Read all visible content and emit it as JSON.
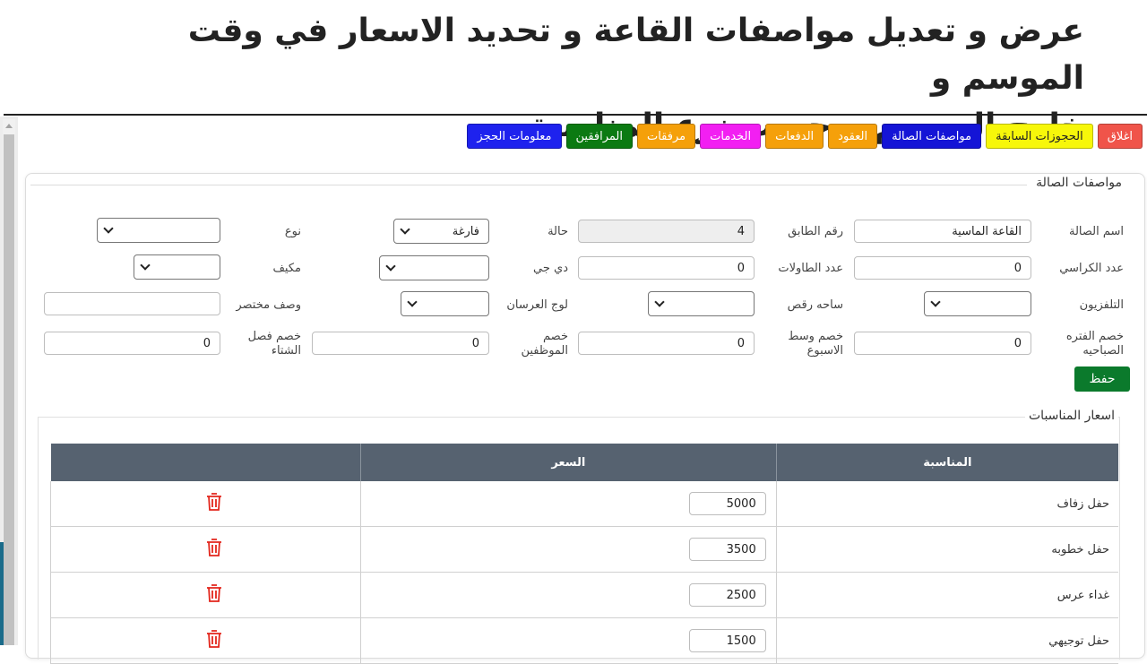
{
  "slide": {
    "title_line1": "عرض و تعديل مواصفات القاعة و تحديد الاسعار في وقت الموسم و",
    "title_line2": "خارج الموسم و حسب نوع المناسبة"
  },
  "toolbar": {
    "buttons": [
      {
        "label": "معلومات الحجز",
        "bg": "#1e22ee",
        "fg": "#ffffff"
      },
      {
        "label": "المرافقين",
        "bg": "#0b7a12",
        "fg": "#ffffff"
      },
      {
        "label": "مرفقات",
        "bg": "#f5a00a",
        "fg": "#ffffff"
      },
      {
        "label": "الخدمات",
        "bg": "#f21ff2",
        "fg": "#ffffff"
      },
      {
        "label": "الدفعات",
        "bg": "#f5a00a",
        "fg": "#ffffff"
      },
      {
        "label": "العقود",
        "bg": "#f5a00a",
        "fg": "#ffffff"
      },
      {
        "label": "مواصفات الصالة",
        "bg": "#1414d6",
        "fg": "#ffffff"
      },
      {
        "label": "الحجوزات السابقة",
        "bg": "#f7f70a",
        "fg": "#222222"
      },
      {
        "label": "اغلاق",
        "bg": "#f0544a",
        "fg": "#ffffff"
      }
    ]
  },
  "specs": {
    "legend": "مواصفات الصالة",
    "hall_name_label": "اسم الصالة",
    "hall_name_value": "القاعة الماسية",
    "floor_label": "رقم الطابق",
    "floor_value": "4",
    "status_label": "حالة",
    "status_value": "فارغة",
    "type_label": "نوع",
    "type_value": "",
    "chairs_label": "عدد الكراسي",
    "chairs_value": "0",
    "tables_label": "عدد الطاولات",
    "tables_value": "0",
    "dj_label": "دي جي",
    "dj_value": "",
    "ac_label": "مكيف",
    "ac_value": "",
    "tv_label": "التلفزيون",
    "tv_value": "",
    "dance_label": "ساحه رقص",
    "dance_value": "",
    "stage_label": "لوج العرسان",
    "stage_value": "",
    "short_desc_label": "وصف مختصر",
    "short_desc_value": "",
    "morning_disc_label": "خصم الفتره الصباحيه",
    "morning_disc_value": "0",
    "midweek_disc_label": "خصم وسط الاسبوع",
    "midweek_disc_value": "0",
    "staff_disc_label": "خصم الموظفين",
    "staff_disc_value": "0",
    "winter_disc_label": "خصم فصل الشتاء",
    "winter_disc_value": "0",
    "save_label": "حفظ"
  },
  "prices": {
    "legend": "اسعار المناسبات",
    "col_occasion": "المناسبة",
    "col_price": "السعر",
    "rows": [
      {
        "occasion": "حفل زفاف",
        "price": "5000"
      },
      {
        "occasion": "حفل خطوبه",
        "price": "3500"
      },
      {
        "occasion": "غداء عرس",
        "price": "2500"
      },
      {
        "occasion": "حفل توجيهي",
        "price": "1500"
      }
    ]
  }
}
